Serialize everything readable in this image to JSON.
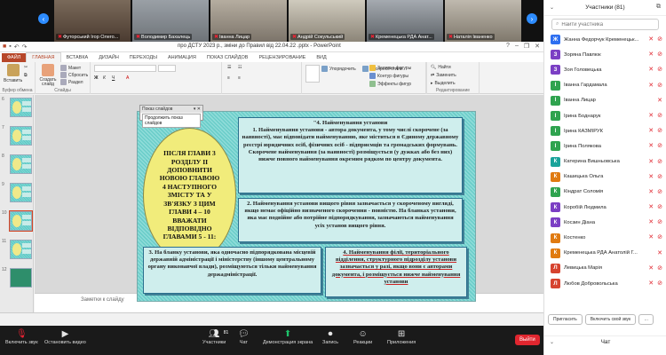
{
  "video_tiles": [
    {
      "name": "Футорський Ігор Олего...",
      "bg": "#6b5a4a"
    },
    {
      "name": "Володимир Бахалець",
      "bg": "#8a8f94"
    },
    {
      "name": "Іванна Лицар",
      "bg": "#9a9288"
    },
    {
      "name": "Андрій Сокульський",
      "bg": "#b3aea2"
    },
    {
      "name": "Кременецька РДА Анат...",
      "bg": "#8f949a"
    },
    {
      "name": "Наталія Іваненко",
      "bg": "#a49f96"
    }
  ],
  "ppt": {
    "title": "про ДСТУ 2023 р., зміни до Правил  від 22.04.22 .pptx - PowerPoint",
    "tabs": [
      "ФАЙЛ",
      "ГЛАВНАЯ",
      "ВСТАВКА",
      "ДИЗАЙН",
      "ПЕРЕХОДЫ",
      "АНИМАЦИЯ",
      "ПОКАЗ СЛАЙДОВ",
      "РЕЦЕНЗИРОВАНИЕ",
      "ВИД"
    ],
    "ribbon": {
      "paste": "Вставить",
      "clipboard_group": "Буфер обмена",
      "new_slide": "Создать слайд",
      "layout": "Макет",
      "reset": "Сбросить",
      "section": "Раздел",
      "slides_group": "Слайды",
      "arrange": "Упорядочить",
      "quick_styles": "Экспресс-стили",
      "fill": "Заливка фигуры",
      "outline": "Контур фигуры",
      "effects": "Эффекты фигур",
      "find": "Найти",
      "replace": "Заменить",
      "select": "Выделить",
      "editing_group": "Редактирование"
    },
    "thumb_numbers": [
      "6",
      "7",
      "8",
      "9",
      "10",
      "11",
      "12"
    ],
    "notes_placeholder": "Заметки к слайду",
    "popup": {
      "title": "Показ слайдов",
      "button": "Продолжить показ слайдов"
    }
  },
  "slide": {
    "oval_text": "ПІСЛЯ ГЛАВИ 3 РОЗДІЛУ ІІ ДОПОВНИТИ НОВОЮ ГЛАВОЮ 4 НАСТУПНОГО ЗМІСТУ ТА У ЗВ'ЯЗКУ З ЦИМ ГЛАВИ  4 – 10 ВВАЖАТИ ВІДПОВІДНО ГЛАВАМИ 5 - 11:",
    "box1_heading": "\"4. Найменування установи",
    "box1_text": "1. Найменування установи - автора документа, у тому числі скорочене (за наявності), має відповідати найменуванню, яке міститься в Єдиному державному реєстрі юридичних осіб, фізичних осіб - підприємців та громадських формувань. Скорочене найменування (за наявності) розміщується (у дужках або без них) нижче повного найменування окремим рядком по центру документа.",
    "box2_text": "2. Найменування установи вищого рівня зазначається у скороченому вигляді, якщо немає офіційно визначеного скорочення - повністю. На бланках установи, яка має подвійне або потрійне підпорядкування, зазначаються найменування усіх установ вищого рівня.",
    "box3_text": "3. На бланку установи, яка одночасно підпорядкована місцевій державній адміністрації і міністерству (іншому центральному органу виконавчої влади), розміщуються тільки найменування держадміністрації.",
    "box4_text": "4. Найменування філії, територіального відділення, структурного підрозділу установи зазначається у разі, якщо вони є авторами документа, і розміщується нижче найменування установи"
  },
  "participants_panel": {
    "title": "Участники (81)",
    "search_placeholder": "Найти участника",
    "items": [
      {
        "initial": "Ж",
        "name": "Жанна Федорчук Кременецьк...",
        "color": "#2e6ff0",
        "cam_off": true
      },
      {
        "initial": "З",
        "name": "Зоряна Павлюк",
        "color": "#7b3fc4",
        "cam_off": true
      },
      {
        "initial": "З",
        "name": "Зоя Головецька",
        "color": "#7b3fc4",
        "cam_off": true
      },
      {
        "initial": "І",
        "name": "Іванна Гардамала",
        "color": "#2fa34f",
        "cam_off": true
      },
      {
        "initial": "І",
        "name": "Іванна Лицар",
        "color": "#2fa34f",
        "cam_off": false
      },
      {
        "initial": "І",
        "name": "Ірина Боднарук",
        "color": "#2fa34f",
        "cam_off": true
      },
      {
        "initial": "І",
        "name": "Ірина КАЗМІРУК",
        "color": "#2fa34f",
        "cam_off": true
      },
      {
        "initial": "І",
        "name": "Ірина Полякова",
        "color": "#2fa34f",
        "cam_off": true
      },
      {
        "initial": "К",
        "name": "Катерина Вишньовська",
        "color": "#1aa39a",
        "cam_off": true
      },
      {
        "initial": "К",
        "name": "Кашицька Ольга",
        "color": "#e07a10",
        "cam_off": true
      },
      {
        "initial": "К",
        "name": "Кіндрат Соломія",
        "color": "#2fa34f",
        "cam_off": true
      },
      {
        "initial": "К",
        "name": "Коробій Людмила",
        "color": "#7b3fc4",
        "cam_off": true
      },
      {
        "initial": "К",
        "name": "Косзин Діана",
        "color": "#7b3fc4",
        "cam_off": true
      },
      {
        "initial": "К",
        "name": "Костенко",
        "color": "#e07a10",
        "cam_off": true
      },
      {
        "initial": "К",
        "name": "Кременецька РДА Анатолій Г...",
        "color": "#e07a10",
        "cam_off": false
      },
      {
        "initial": "Л",
        "name": "Левицька Марія",
        "color": "#d6432f",
        "cam_off": true
      },
      {
        "initial": "Л",
        "name": "Любов Добровольська",
        "color": "#d6432f",
        "cam_off": true
      }
    ],
    "invite_button": "Пригласить",
    "unmute_all_button": "Включить свой звук",
    "chat_title": "Чат"
  },
  "toolbar": {
    "unmute": "Включить звук",
    "stop_video": "Остановить видео",
    "participants": "Участники",
    "participants_count": "81",
    "chat": "Чат",
    "share_screen": "Демонстрация экрана",
    "record": "Запись",
    "reactions": "Реакции",
    "apps": "Приложения",
    "end": "Выйти"
  }
}
